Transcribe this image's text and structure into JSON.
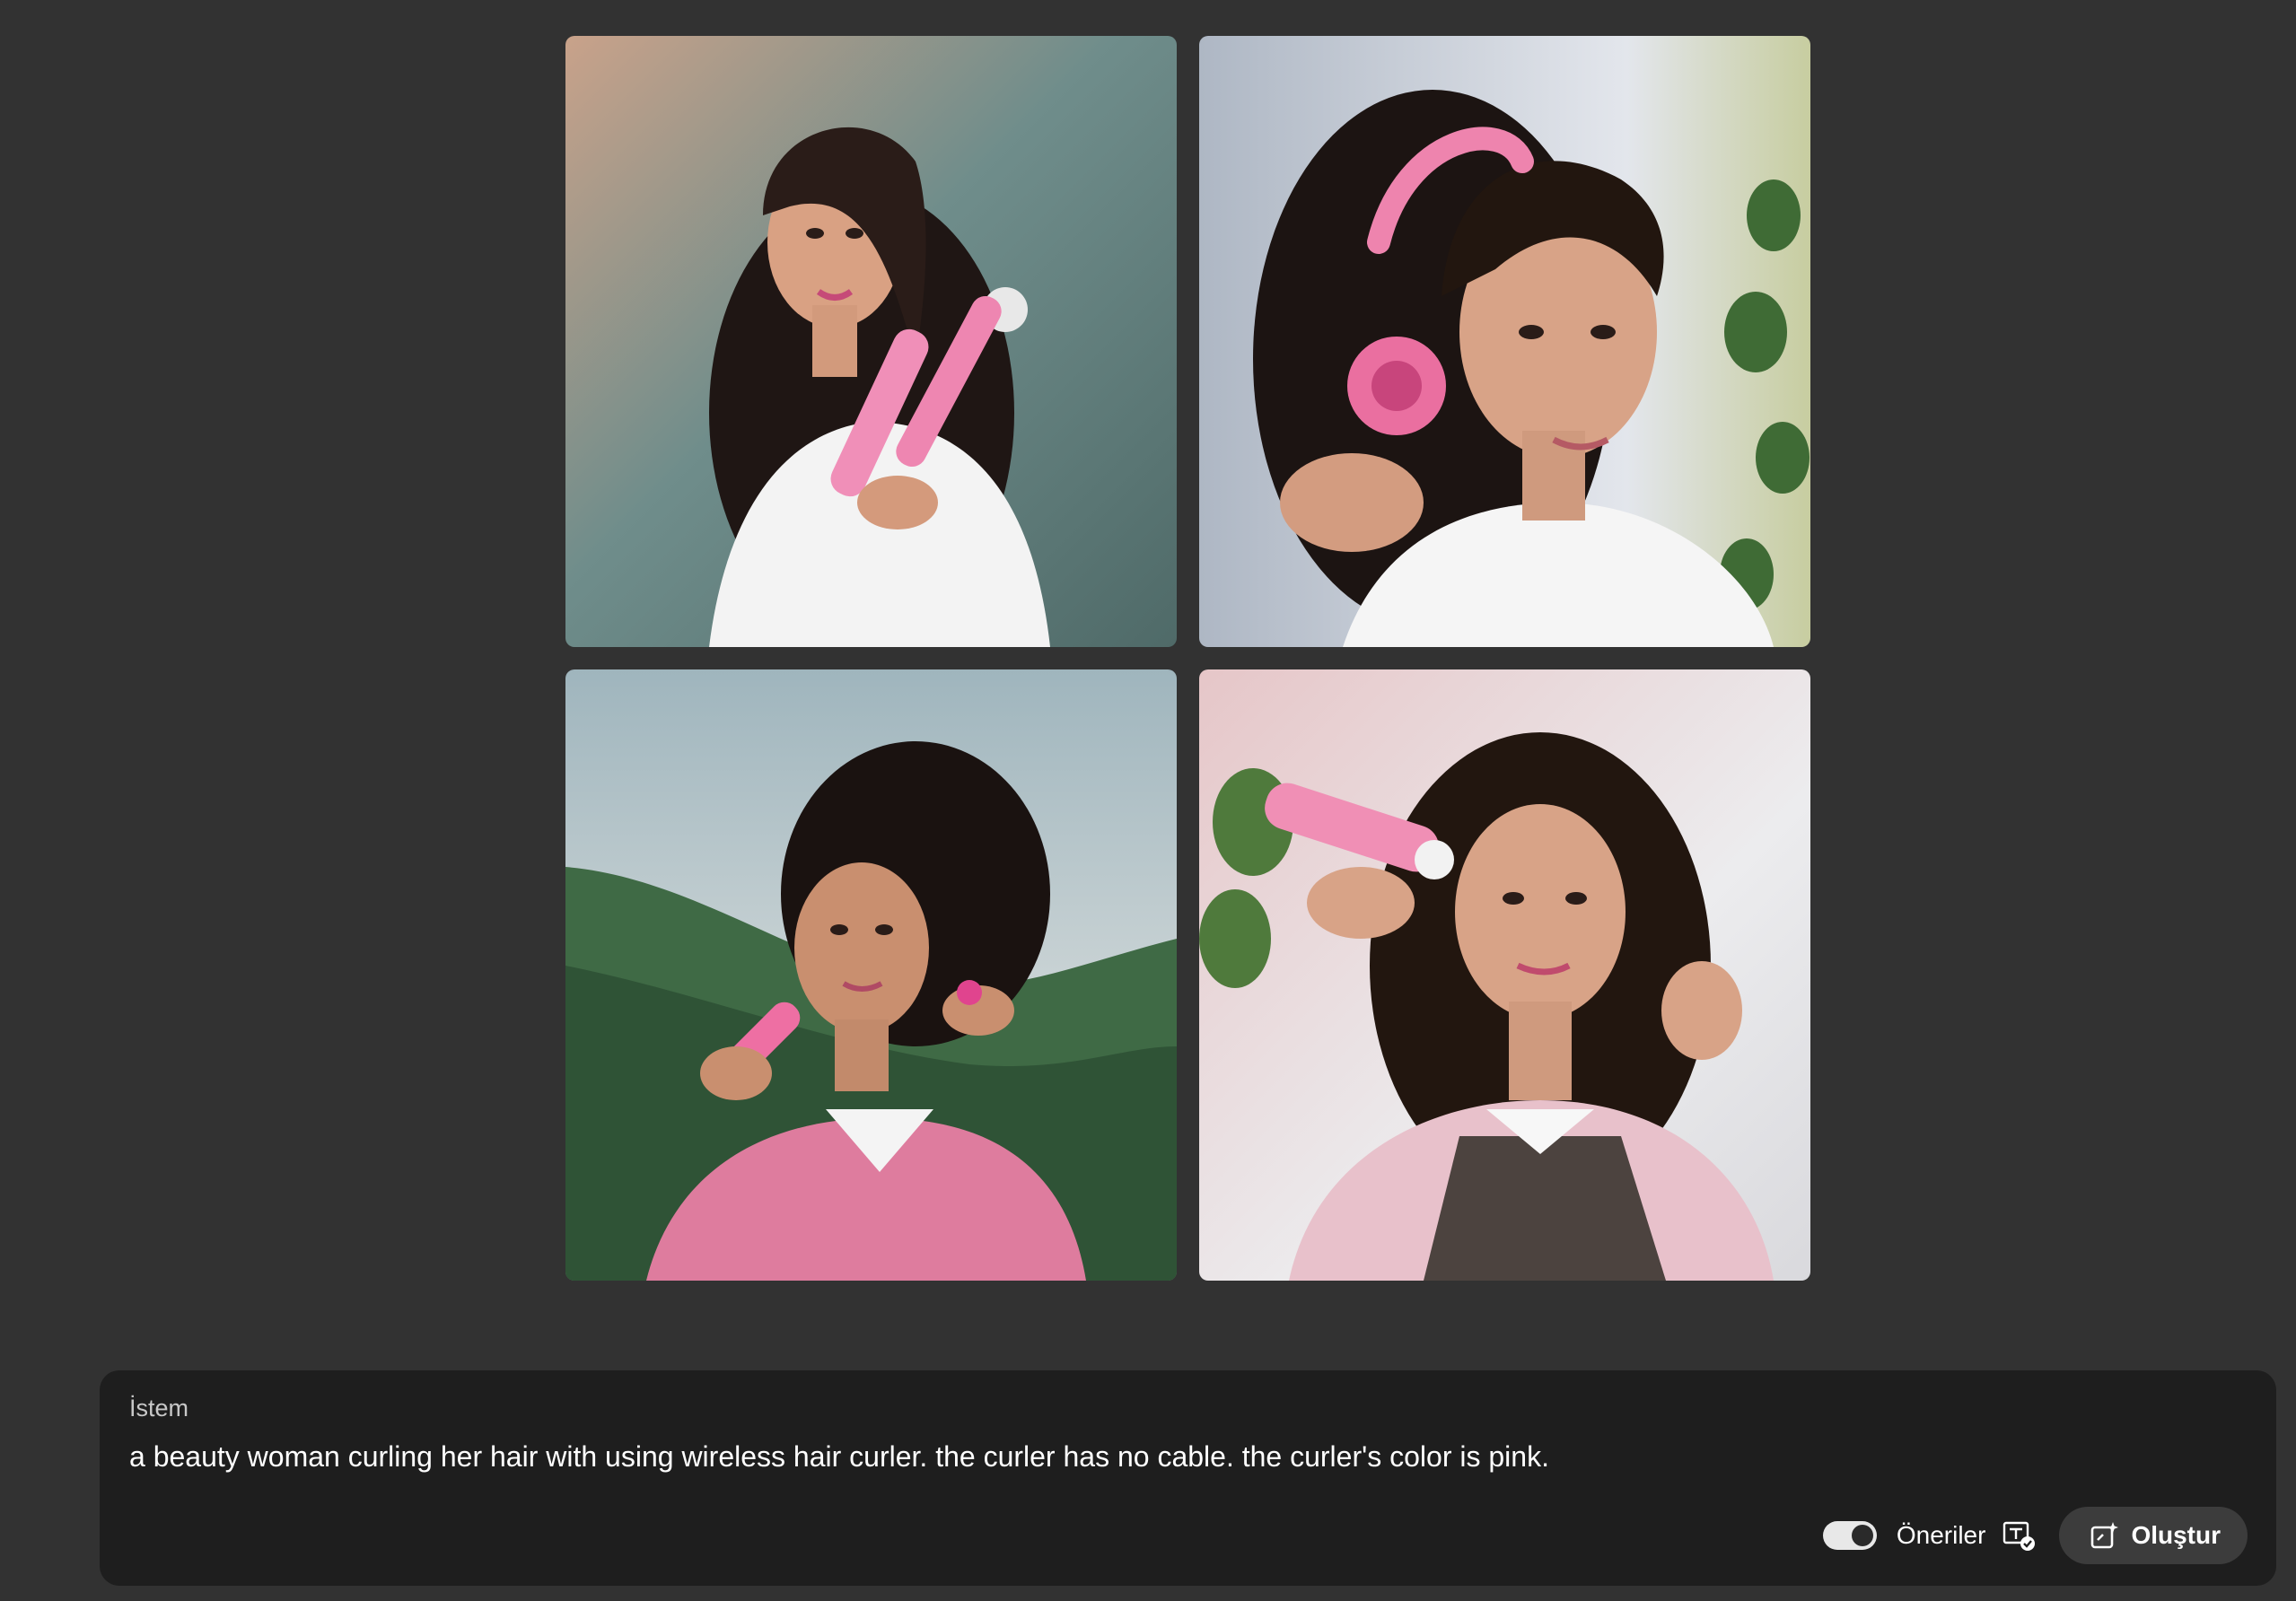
{
  "images": [
    {
      "alt": "Generated image 1"
    },
    {
      "alt": "Generated image 2"
    },
    {
      "alt": "Generated image 3"
    },
    {
      "alt": "Generated image 4"
    }
  ],
  "prompt": {
    "label": "İstem",
    "text": "a beauty woman curling her hair with using wireless hair curler. the curler has no cable. the curler's color is pink."
  },
  "controls": {
    "suggestions_label": "Öneriler",
    "suggestions_enabled": true,
    "content_credentials_icon": "text-check-icon",
    "generate_label": "Oluştur",
    "generate_icon": "generate-sparkle-icon"
  },
  "colors": {
    "background": "#323232",
    "panel": "#1e1e1e",
    "button": "#3c3c3c",
    "accent_pink": "#e8739e"
  }
}
